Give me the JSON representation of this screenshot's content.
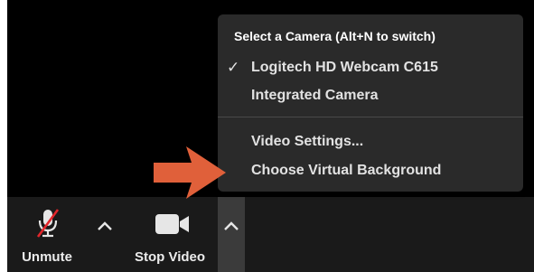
{
  "toolbar": {
    "unmute_label": "Unmute",
    "stop_video_label": "Stop Video",
    "icons": [
      "microphone-muted-icon",
      "chevron-up-icon",
      "video-camera-icon",
      "chevron-up-icon"
    ]
  },
  "camera_menu": {
    "header": "Select a Camera (Alt+N to switch)",
    "cameras": [
      {
        "label": "Logitech HD Webcam C615",
        "selected": true
      },
      {
        "label": "Integrated Camera",
        "selected": false
      }
    ],
    "actions": [
      {
        "label": "Video Settings..."
      },
      {
        "label": "Choose Virtual Background"
      }
    ],
    "checkmark": "✓"
  },
  "annotation": {
    "icon": "orange-arrow-icon",
    "color": "#e0603a"
  },
  "colors": {
    "toolbar_bg": "#1a1a1a",
    "menu_bg": "#2a2a2a",
    "active_chevron_bg": "#3b3b3b"
  }
}
